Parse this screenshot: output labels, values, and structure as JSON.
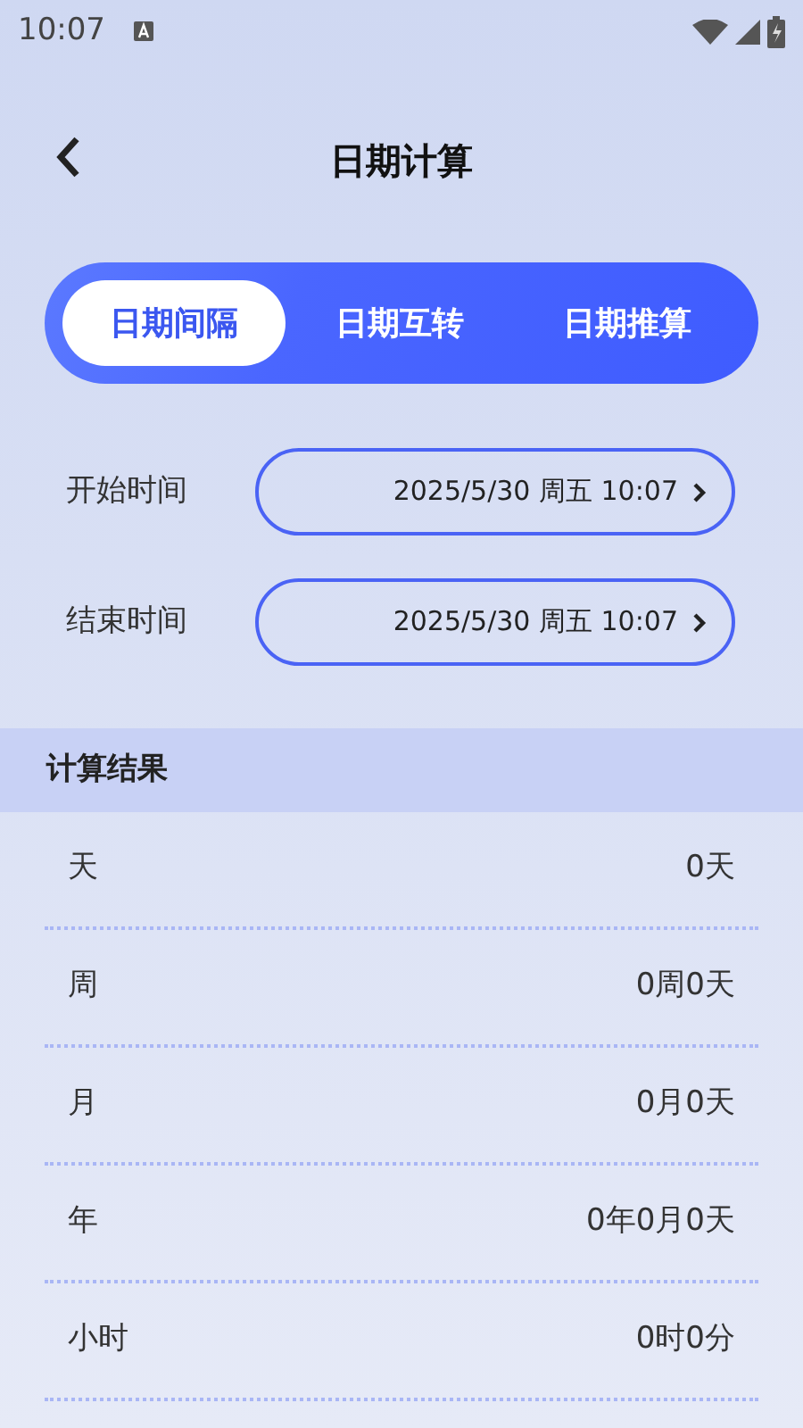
{
  "status_bar": {
    "time": "10:07"
  },
  "header": {
    "title": "日期计算"
  },
  "tabs": [
    {
      "label": "日期间隔",
      "selected": true
    },
    {
      "label": "日期互转",
      "selected": false
    },
    {
      "label": "日期推算",
      "selected": false
    }
  ],
  "fields": [
    {
      "label": "开始时间",
      "value": "2025/5/30 周五 10:07"
    },
    {
      "label": "结束时间",
      "value": "2025/5/30 周五 10:07"
    }
  ],
  "results": {
    "title": "计算结果",
    "rows": [
      {
        "label": "天",
        "value": "0天"
      },
      {
        "label": "周",
        "value": "0周0天"
      },
      {
        "label": "月",
        "value": "0月0天"
      },
      {
        "label": "年",
        "value": "0年0月0天"
      },
      {
        "label": "小时",
        "value": "0时0分"
      }
    ]
  }
}
